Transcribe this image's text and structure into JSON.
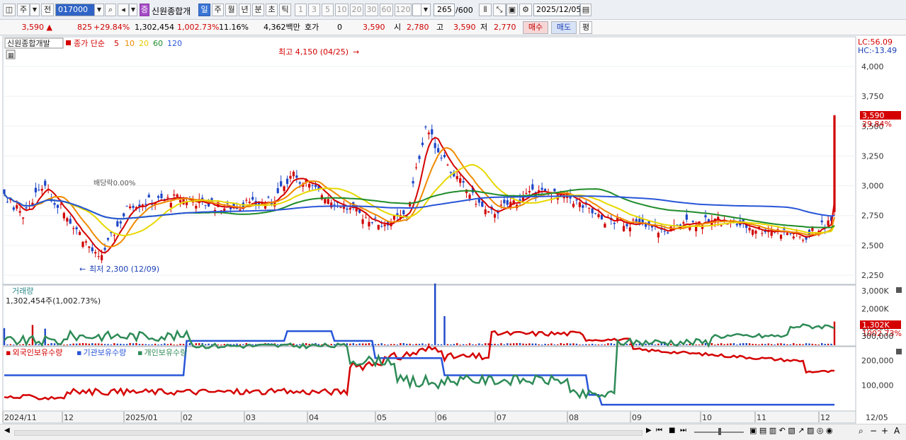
{
  "toolbar": {
    "market_buttons": [
      "주",
      "전"
    ],
    "code_value": "017000",
    "stock_badge": "증",
    "stock_name": "신원종합개",
    "period_tabs": [
      "일",
      "주",
      "월",
      "년",
      "분",
      "초",
      "틱"
    ],
    "period_selected": "일",
    "interval_buttons": [
      "1",
      "3",
      "5",
      "10",
      "20",
      "30",
      "60",
      "120"
    ],
    "count_value": "265",
    "count_total": "/600",
    "date_value": "2025/12/05"
  },
  "quote": {
    "price": "3,590",
    "change": "825",
    "change_rate": "+29.84%",
    "volume": "1,302,454",
    "volume_rate": "1,002.73%",
    "turnover": "11.16%",
    "amount": "4,362백만",
    "hoga_label": "호가",
    "hoga_value": "0",
    "hoga_price": "3,590",
    "open_label": "시",
    "open": "2,780",
    "high_label": "고",
    "high": "3,590",
    "low_label": "저",
    "low": "2,770",
    "buy_label": "매수",
    "sell_label": "매도",
    "avg_label": "평"
  },
  "price_panel": {
    "title": "신원종합개발",
    "ma_label": "종가 단순",
    "ma_periods": [
      "5",
      "10",
      "20",
      "60",
      "120"
    ],
    "lc": "LC:56.09",
    "hc": "HC:-13.49",
    "y_ticks": [
      "4,000",
      "3,750",
      "3,500",
      "3,250",
      "3,000",
      "2,750",
      "2,500",
      "2,250"
    ],
    "current_price_tag": "3,590",
    "current_rate_tag": "29.84%",
    "high_annotation": "최고 4,150 (04/25)",
    "low_annotation": "최저 2,300 (12/09)",
    "overlay_text": "배당락0.00%"
  },
  "volume_panel": {
    "title": "거래량",
    "info": "1,302,454주(1,002.73%)",
    "y_ticks": [
      "3,000K",
      "2,000K",
      "1,000K"
    ],
    "current_tag": "1,302K",
    "current_rate": "1002.73%"
  },
  "holding_panel": {
    "legend": [
      "외국인보유수량",
      "기관보유수량",
      "개인보유수량"
    ],
    "y_ticks": [
      "300,000",
      "200,000",
      "100,000"
    ]
  },
  "x_axis": {
    "labels": [
      "2024/11",
      "12",
      "2025/01",
      "02",
      "03",
      "04",
      "05",
      "06",
      "07",
      "08",
      "09",
      "10",
      "11",
      "12"
    ],
    "end_label": "12/05"
  },
  "colors": {
    "up": "#d00000",
    "down": "#1e46c8",
    "ma5": "#d40000",
    "ma10": "#f08a00",
    "ma20": "#e6d800",
    "ma60": "#1f8c2a",
    "ma120": "#2855d8",
    "foreign": "#d40000",
    "institution": "#2855d8",
    "individual": "#2e8b57"
  },
  "icons": [
    "layout-icon",
    "search-icon",
    "speaker-icon",
    "candle-icon",
    "line-icon",
    "grid-icon",
    "save-icon",
    "gear-icon",
    "calendar-icon",
    "zoom-in-icon",
    "zoom-out-icon"
  ]
}
